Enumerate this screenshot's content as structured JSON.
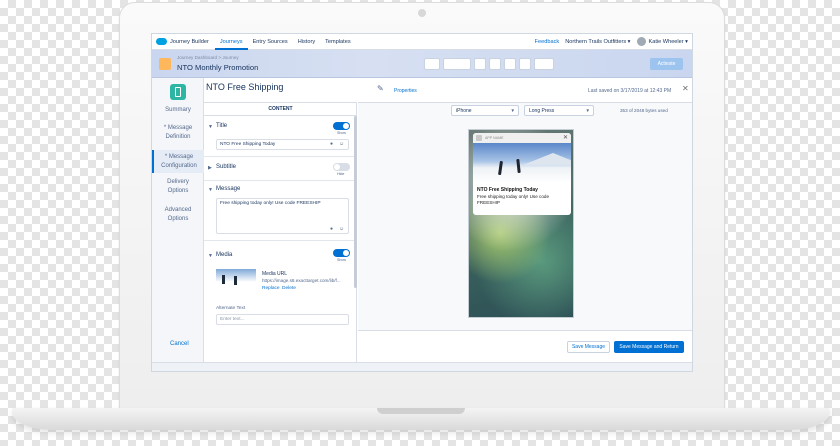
{
  "topnav": {
    "app_name": "Journey Builder",
    "tabs": [
      {
        "label": "Journeys",
        "active": true
      },
      {
        "label": "Entry Sources",
        "active": false
      },
      {
        "label": "History",
        "active": false
      },
      {
        "label": "Templates",
        "active": false
      }
    ],
    "feedback": "Feedback",
    "org": "Northern Trails Outfitters ▾",
    "user": "Katie Wheeler ▾"
  },
  "header": {
    "breadcrumb": "Journey Dashboard > Journey",
    "title": "NTO Monthly Promotion",
    "activate": "Activate"
  },
  "leftnav": {
    "items": [
      {
        "label": "Summary",
        "active": false
      },
      {
        "label": "* Message Definition",
        "active": false
      },
      {
        "label": "* Message Configuration",
        "active": true
      },
      {
        "label": "Delivery Options",
        "active": false
      },
      {
        "label": "Advanced Options",
        "active": false
      }
    ],
    "cancel": "Cancel"
  },
  "panel": {
    "title": "NTO Free Shipping",
    "properties": "Properties",
    "saved": "Last saved on 3/17/2019 at 12:43 PM"
  },
  "content": {
    "heading": "CONTENT",
    "title_section": {
      "label": "Title",
      "toggle_label": "Show",
      "value": "NTO Free Shipping Today"
    },
    "subtitle_section": {
      "label": "Subtitle",
      "toggle_label": "Hide"
    },
    "message_section": {
      "label": "Message",
      "value": "Free shipping today only! Use code FREESHIP"
    },
    "media_section": {
      "label": "Media",
      "toggle_label": "Show",
      "media_url_label": "Media URL",
      "media_url_value": "https://image.s8.exacttarget.com/lib/f...",
      "replace": "Replace",
      "delete": "Delete",
      "alt_label": "Alternate Text",
      "alt_placeholder": "Enter text..."
    }
  },
  "preview": {
    "device": "iPhone",
    "mode": "Long Press",
    "bytes_used": "353 of 2048 bytes used",
    "app_name": "APP NAME",
    "notif_title": "NTO Free Shipping Today",
    "notif_body": "Free shipping today only! Use code FREESHIP"
  },
  "footer": {
    "save": "Save Message",
    "save_return": "Save Message and Return"
  },
  "colors": {
    "brand_blue": "#0070d2",
    "teal_icon": "#2fb5a3"
  }
}
